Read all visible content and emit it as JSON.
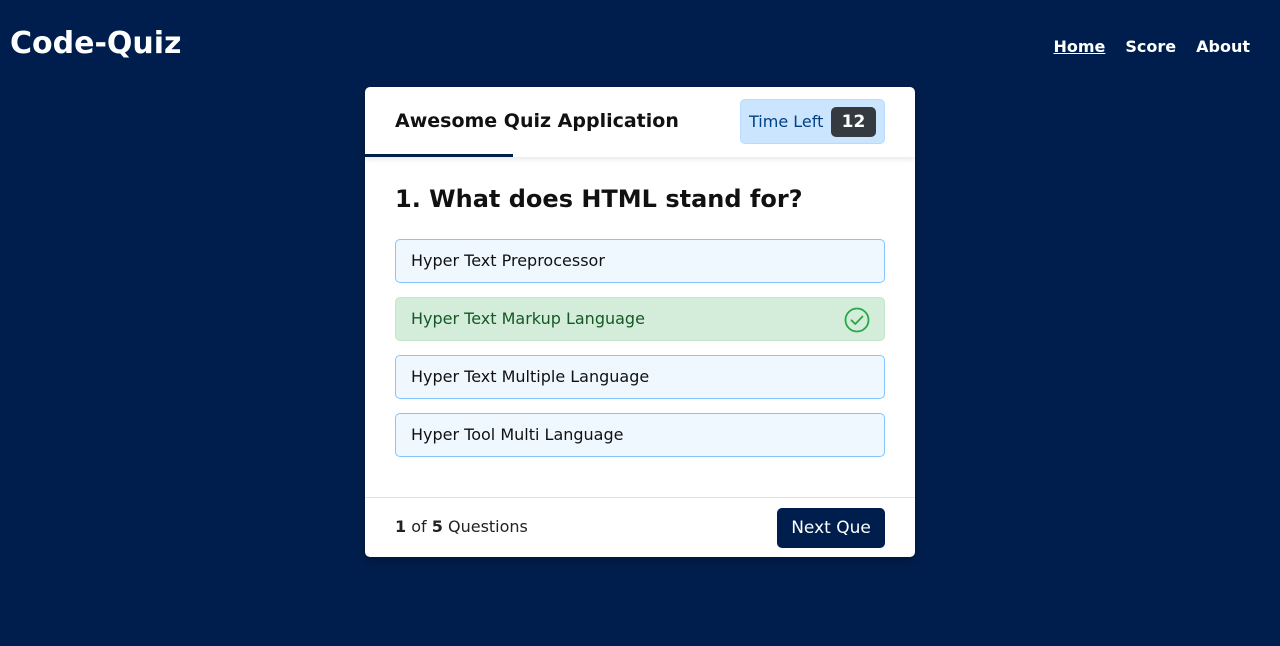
{
  "navbar": {
    "brand": "Code-Quiz",
    "links": [
      {
        "label": "Home",
        "active": true
      },
      {
        "label": "Score",
        "active": false
      },
      {
        "label": "About",
        "active": false
      }
    ]
  },
  "quiz": {
    "title": "Awesome Quiz Application",
    "timer": {
      "label": "Time Left",
      "seconds": "12"
    },
    "question": "1. What does HTML stand for?",
    "options": [
      {
        "text": "Hyper Text Preprocessor",
        "state": "default"
      },
      {
        "text": "Hyper Text Markup Language",
        "state": "correct",
        "icon": "check-circle-icon"
      },
      {
        "text": "Hyper Text Multiple Language",
        "state": "default"
      },
      {
        "text": "Hyper Tool Multi Language",
        "state": "default"
      }
    ],
    "footer": {
      "current": "1",
      "of": "of",
      "total": "5",
      "suffix": "Questions",
      "next_label": "Next Que"
    }
  },
  "colors": {
    "background": "#001e4d",
    "correct_bg": "#d4edda",
    "correct_text": "#155724",
    "timer_bg": "#cce5ff"
  }
}
